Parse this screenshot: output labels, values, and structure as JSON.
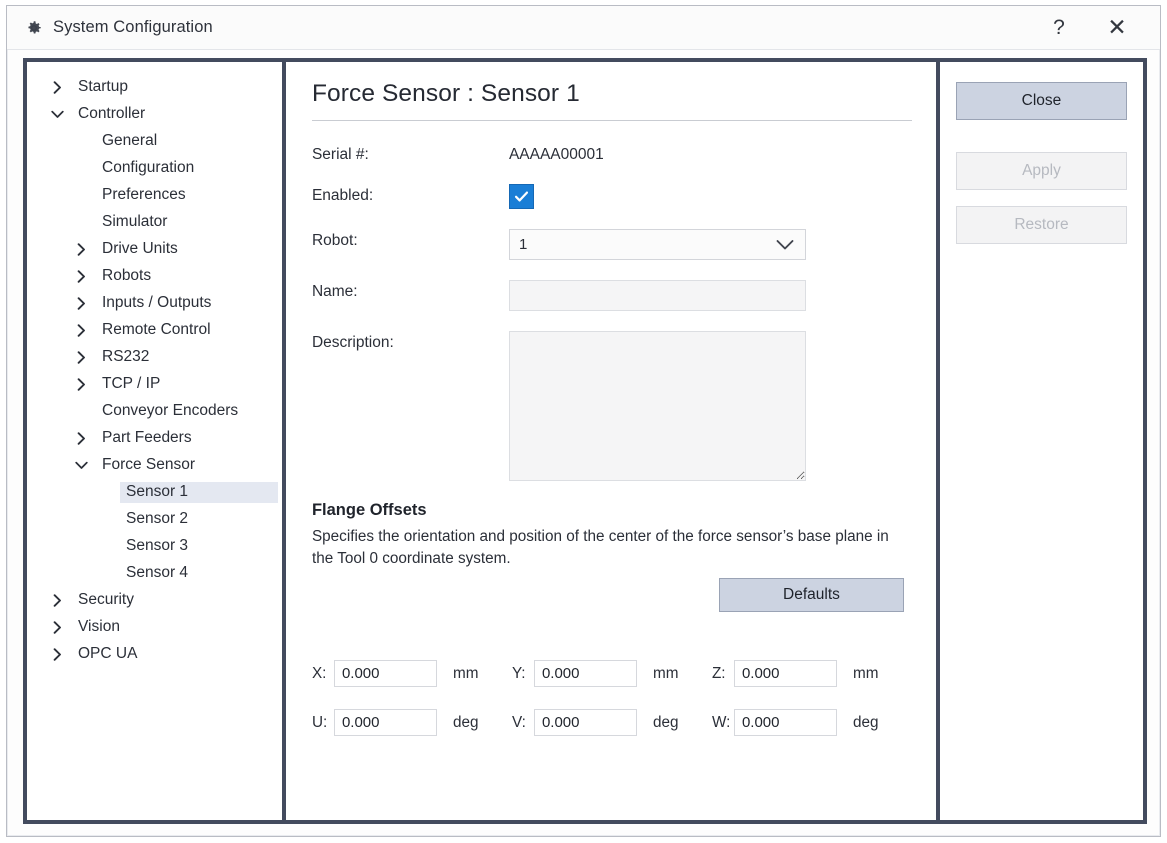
{
  "window": {
    "title": "System Configuration",
    "gear_icon": "gear-icon",
    "help_label": "?",
    "close_label": "✕"
  },
  "sidebar": {
    "items": [
      {
        "label": "Startup",
        "level": 1,
        "arrow": "collapsed",
        "selected": false
      },
      {
        "label": "Controller",
        "level": 1,
        "arrow": "expanded",
        "selected": false
      },
      {
        "label": "General",
        "level": 2,
        "arrow": "none",
        "selected": false
      },
      {
        "label": "Configuration",
        "level": 2,
        "arrow": "none",
        "selected": false
      },
      {
        "label": "Preferences",
        "level": 2,
        "arrow": "none",
        "selected": false
      },
      {
        "label": "Simulator",
        "level": 2,
        "arrow": "none",
        "selected": false
      },
      {
        "label": "Drive Units",
        "level": 2,
        "arrow": "collapsed",
        "selected": false
      },
      {
        "label": "Robots",
        "level": 2,
        "arrow": "collapsed",
        "selected": false
      },
      {
        "label": "Inputs / Outputs",
        "level": 2,
        "arrow": "collapsed",
        "selected": false
      },
      {
        "label": "Remote Control",
        "level": 2,
        "arrow": "collapsed",
        "selected": false
      },
      {
        "label": "RS232",
        "level": 2,
        "arrow": "collapsed",
        "selected": false
      },
      {
        "label": "TCP / IP",
        "level": 2,
        "arrow": "collapsed",
        "selected": false
      },
      {
        "label": "Conveyor Encoders",
        "level": 2,
        "arrow": "none",
        "selected": false
      },
      {
        "label": "Part Feeders",
        "level": 2,
        "arrow": "collapsed",
        "selected": false
      },
      {
        "label": "Force Sensor",
        "level": 2,
        "arrow": "expanded",
        "selected": false
      },
      {
        "label": "Sensor 1",
        "level": 3,
        "arrow": "none",
        "selected": true
      },
      {
        "label": "Sensor 2",
        "level": 3,
        "arrow": "none",
        "selected": false
      },
      {
        "label": "Sensor 3",
        "level": 3,
        "arrow": "none",
        "selected": false
      },
      {
        "label": "Sensor 4",
        "level": 3,
        "arrow": "none",
        "selected": false
      },
      {
        "label": "Security",
        "level": 1,
        "arrow": "collapsed",
        "selected": false
      },
      {
        "label": "Vision",
        "level": 1,
        "arrow": "collapsed",
        "selected": false
      },
      {
        "label": "OPC UA",
        "level": 1,
        "arrow": "collapsed",
        "selected": false
      }
    ],
    "selection_color": "#e4e8f1"
  },
  "main": {
    "page_title": "Force Sensor : Sensor 1",
    "fields": {
      "serial_label": "Serial #:",
      "serial_value": "AAAAA00001",
      "enabled_label": "Enabled:",
      "enabled_checked": true,
      "robot_label": "Robot:",
      "robot_value": "1",
      "name_label": "Name:",
      "name_value": "",
      "name_placeholder": "",
      "description_label": "Description:",
      "description_value": "",
      "description_placeholder": ""
    },
    "flange": {
      "title": "Flange Offsets",
      "description": "Specifies the orientation and position of the center of the force sensor’s base plane in the Tool 0 coordinate system.",
      "defaults_label": "Defaults",
      "rows": [
        [
          {
            "label": "X:",
            "value": "0.000",
            "unit": "mm"
          },
          {
            "label": "Y:",
            "value": "0.000",
            "unit": "mm"
          },
          {
            "label": "Z:",
            "value": "0.000",
            "unit": "mm"
          }
        ],
        [
          {
            "label": "U:",
            "value": "0.000",
            "unit": "deg"
          },
          {
            "label": "V:",
            "value": "0.000",
            "unit": "deg"
          },
          {
            "label": "W:",
            "value": "0.000",
            "unit": "deg"
          }
        ]
      ]
    }
  },
  "buttons": {
    "close_label": "Close",
    "apply_label": "Apply",
    "restore_label": "Restore",
    "apply_enabled": false,
    "restore_enabled": false,
    "primary_color": "#ccd3e1",
    "disabled_color": "#f3f3f4"
  }
}
